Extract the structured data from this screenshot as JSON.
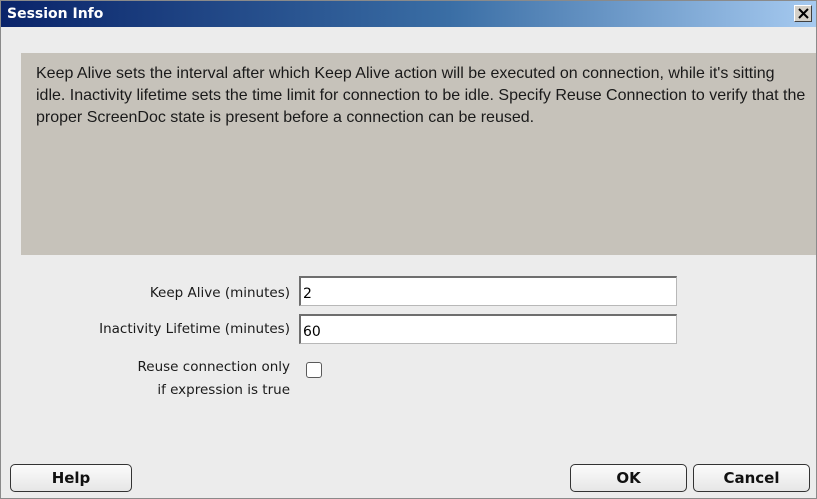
{
  "window": {
    "title": "Session Info"
  },
  "description": "Keep Alive sets the interval after which Keep Alive action will be executed on connection, while it's sitting idle. Inactivity lifetime sets the time limit for connection to be idle. Specify Reuse Connection to verify that the proper ScreenDoc state is present before a connection can be reused.",
  "form": {
    "keep_alive_label": "Keep Alive (minutes)",
    "keep_alive_value": "2",
    "inactivity_label": "Inactivity Lifetime (minutes)",
    "inactivity_value": "60",
    "reuse_label_line1": "Reuse connection only",
    "reuse_label_line2": "if expression is true",
    "reuse_checked": false
  },
  "buttons": {
    "help": "Help",
    "ok": "OK",
    "cancel": "Cancel"
  },
  "icons": {
    "close": "close-icon"
  },
  "colors": {
    "titlebar_start": "#0a246a",
    "titlebar_end": "#a6caf0",
    "dialog_bg": "#ececec",
    "description_bg": "#c6c2ba"
  }
}
